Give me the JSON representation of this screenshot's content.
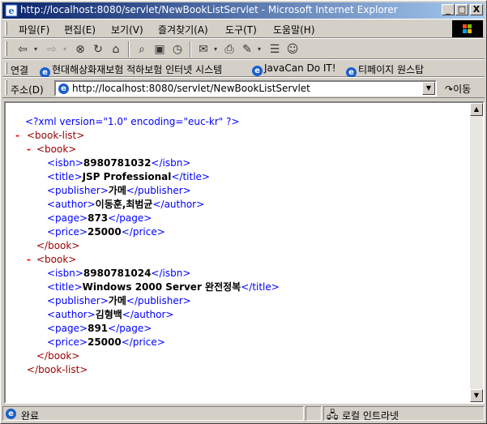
{
  "window": {
    "title": "http://localhost:8080/servlet/NewBookListServlet - Microsoft Internet Explorer",
    "controls": {
      "minimize": "_",
      "maximize": "□",
      "close": "X"
    }
  },
  "menu": {
    "items": [
      "파일(F)",
      "편집(E)",
      "보기(V)",
      "즐겨찾기(A)",
      "도구(T)",
      "도움말(H)"
    ]
  },
  "toolbar": {
    "buttons": [
      "back-icon",
      "forward-icon",
      "stop-icon",
      "refresh-icon",
      "home-icon",
      "search-icon",
      "favorites-icon",
      "history-icon",
      "mail-icon",
      "print-icon",
      "edit-icon",
      "discuss-icon",
      "messenger-icon"
    ]
  },
  "links": {
    "label": "연결",
    "items": [
      "현대해상화재보험 적하보험 인터넷 시스템",
      "JavaCan Do IT!",
      "티페이지 원스탑"
    ]
  },
  "address": {
    "label": "주소(D)",
    "url": "http://localhost:8080/servlet/NewBookListServlet",
    "go_label": "이동"
  },
  "xml": {
    "declaration": "<?xml version=\"1.0\" encoding=\"euc-kr\" ?>",
    "minus": "-",
    "root_open": "<book-list>",
    "root_close": "</book-list>",
    "book_open": "<book>",
    "book_close": "</book>",
    "books": [
      {
        "isbn": "8980781032",
        "title": "JSP Professional",
        "publisher": "가메",
        "author": "이동훈,최범균",
        "page": "873",
        "price": "25000"
      },
      {
        "isbn": "8980781024",
        "title": "Windows 2000 Server 완전정복",
        "publisher": "가메",
        "author": "김형백",
        "page": "891",
        "price": "25000"
      }
    ],
    "tags": {
      "isbn_open": "<isbn>",
      "isbn_close": "</isbn>",
      "title_open": "<title>",
      "title_close": "</title>",
      "publisher_open": "<publisher>",
      "publisher_close": "</publisher>",
      "author_open": "<author>",
      "author_close": "</author>",
      "page_open": "<page>",
      "page_close": "</page>",
      "price_open": "<price>",
      "price_close": "</price>"
    }
  },
  "status": {
    "text": "완료",
    "zone": "로컬 인트라넷"
  }
}
